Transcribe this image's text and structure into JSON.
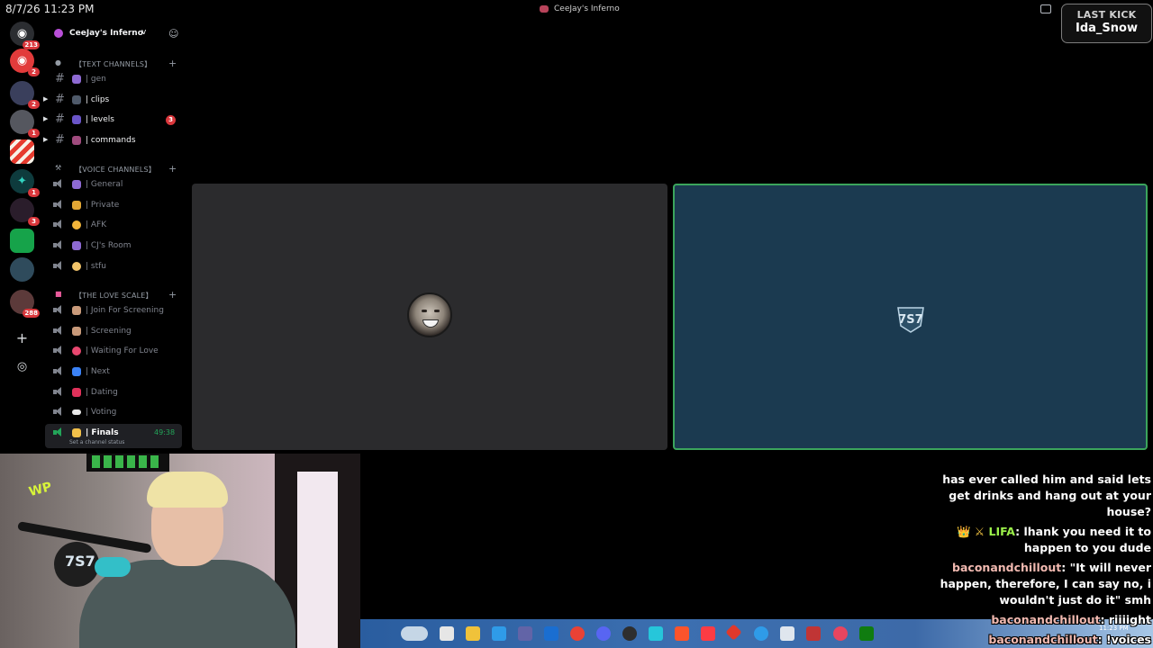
{
  "topbar": {
    "datetime": "8/7/26 11:23 PM",
    "window_title": "CeeJay's Inferno"
  },
  "last_kick": {
    "label": "LAST KICK",
    "name": "Ida_Snow"
  },
  "server_rail": {
    "home_badge": "213",
    "badges": [
      "2",
      "2",
      "1",
      "1",
      "3",
      "288"
    ]
  },
  "guild": {
    "name": "CeeJay's Inferno",
    "chevron": "v"
  },
  "categories": {
    "text": "【TEXT CHANNELS】",
    "voice": "【VOICE CHANNELS】",
    "love": "【THE LOVE SCALE】"
  },
  "text_channels": [
    {
      "label": "| gen"
    },
    {
      "label": "| clips"
    },
    {
      "label": "| levels",
      "mention": "3"
    },
    {
      "label": "| commands"
    }
  ],
  "voice_channels": [
    {
      "label": "| General"
    },
    {
      "label": "| Private"
    },
    {
      "label": "| AFK"
    },
    {
      "label": "| CJ's Room"
    },
    {
      "label": "| stfu"
    }
  ],
  "love_channels": [
    {
      "label": "| Join For Screening"
    },
    {
      "label": "| Screening"
    },
    {
      "label": "| Waiting For Love"
    },
    {
      "label": "| Next"
    },
    {
      "label": "| Dating"
    },
    {
      "label": "| Voting"
    },
    {
      "label": "| Finals",
      "timer": "49:38",
      "status": "Set a channel status"
    }
  ],
  "stage": {
    "right_logo": "7S7"
  },
  "webcam": {
    "mic_logo": "7S7",
    "sticker": "WP"
  },
  "taskbar": {
    "clock": "11:23 PM"
  },
  "chat": [
    {
      "text": "has ever called him and said lets get drinks and hang out at your house?"
    },
    {
      "badges": "👑 ⚔",
      "user": "LIFA",
      "text": ": lhank you need it to happen to you dude"
    },
    {
      "user": "baconandchillout",
      "text": ": \"It will never happen, therefore, I can say no, i wouldn't just do it\" smh"
    },
    {
      "user": "baconandchillout",
      "text": ": riiiight"
    },
    {
      "user": "baconandchillout",
      "text": ": !voices"
    }
  ],
  "colors": {
    "accent_green": "#23a559",
    "mention_red": "#da373c",
    "right_tile": "#1b3a50",
    "left_tile": "#2b2b2d"
  }
}
